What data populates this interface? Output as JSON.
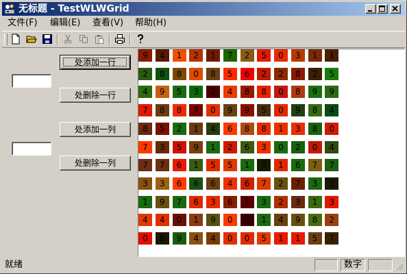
{
  "window": {
    "title": "无标题 - TestWLWGrid",
    "icon": "app-icon",
    "buttons": [
      "minimize-icon",
      "maximize-icon",
      "close-icon"
    ]
  },
  "menu": [
    "文件(F)",
    "编辑(E)",
    "查看(V)",
    "帮助(H)"
  ],
  "toolbar": {
    "tools": [
      "new-file-icon",
      "open-folder-icon",
      "save-icon",
      "cut-icon",
      "copy-icon",
      "paste-icon",
      "print-icon",
      "help-icon"
    ]
  },
  "panel": {
    "add_row": "处添加一行",
    "delete_row": "处删除一行",
    "add_col": "处添加一列",
    "delete_col": "处删除一列",
    "row_input_value": "",
    "col_input_value": ""
  },
  "grid": {
    "values": [
      [
        "9",
        "4",
        "1",
        "2",
        "1",
        "7",
        "2",
        "5",
        "0",
        "3",
        "1",
        "1"
      ],
      [
        "2",
        "8",
        "8",
        "0",
        "8",
        "5",
        "6",
        "2",
        "2",
        "8",
        "2",
        "5"
      ],
      [
        "4",
        "9",
        "5",
        "3",
        "2",
        "4",
        "8",
        "8",
        "0",
        "8",
        "9",
        "9"
      ],
      [
        "7",
        "8",
        "8",
        "7",
        "0",
        "9",
        "9",
        "5",
        "0",
        "9",
        "8",
        "4"
      ],
      [
        "8",
        "5",
        "2",
        "1",
        "4",
        "6",
        "8",
        "8",
        "1",
        "3",
        "8",
        "0"
      ],
      [
        "7",
        "3",
        "5",
        "9",
        "1",
        "2",
        "6",
        "3",
        "0",
        "2",
        "0",
        "4"
      ],
      [
        "7",
        "7",
        "6",
        "1",
        "5",
        "5",
        "1",
        "0",
        "1",
        "6",
        "7",
        "7"
      ],
      [
        "3",
        "3",
        "6",
        "6",
        "6",
        "4",
        "6",
        "7",
        "2",
        "7",
        "3",
        "2"
      ],
      [
        "1",
        "9",
        "7",
        "6",
        "3",
        "6",
        "7",
        "3",
        "2",
        "3",
        "1",
        "3"
      ],
      [
        "4",
        "4",
        "0",
        "1",
        "9",
        "0",
        "8",
        "1",
        "4",
        "9",
        "8",
        "2"
      ],
      [
        "0",
        "8",
        "9",
        "4",
        "4",
        "0",
        "0",
        "5",
        "1",
        "1",
        "5",
        "7"
      ]
    ],
    "colors": [
      [
        "#8b1a00",
        "#5a1a00",
        "#f05000",
        "#b83000",
        "#6e1a00",
        "#1e6400",
        "#8a5a14",
        "#e01a00",
        "#e82a00",
        "#b83a00",
        "#7a2a00",
        "#4a2000"
      ],
      [
        "#2a5a10",
        "#105010",
        "#7a4a00",
        "#e04a00",
        "#6a4010",
        "#ff2a00",
        "#f00000",
        "#c01a00",
        "#8a2a00",
        "#8a1a00",
        "#3a2000",
        "#1a7a10"
      ],
      [
        "#2a6a10",
        "#c86010",
        "#1a6a10",
        "#0a6a0a",
        "#4a0000",
        "#ee3a00",
        "#9a1a00",
        "#e82200",
        "#c01a10",
        "#b03a10",
        "#1a7010",
        "#2a6a10"
      ],
      [
        "#e01a00",
        "#6a3a10",
        "#f02a00",
        "#7a0000",
        "#e03000",
        "#6a4010",
        "#8a1000",
        "#4a2a10",
        "#e02800",
        "#204010",
        "#3a6a10",
        "#0a4a10"
      ],
      [
        "#6a2a10",
        "#7a1000",
        "#1a6a10",
        "#6a3a10",
        "#2a3a10",
        "#ff3a00",
        "#b04a10",
        "#e82a00",
        "#ee3000",
        "#e83000",
        "#1a6010",
        "#d01a00"
      ],
      [
        "#ff3a00",
        "#6a2a00",
        "#d01000",
        "#7a4010",
        "#1a6a10",
        "#d01a00",
        "#3a5a10",
        "#ee3000",
        "#1a6a10",
        "#1a6010",
        "#c01a00",
        "#304a10"
      ],
      [
        "#6a3010",
        "#6a3010",
        "#e81a00",
        "#3a5a10",
        "#e02a00",
        "#e03a00",
        "#1a6a10",
        "#1a1a00",
        "#e02800",
        "#1a6a10",
        "#7a6010",
        "#1a6010"
      ],
      [
        "#8a5010",
        "#a06010",
        "#ff3a00",
        "#1a5010",
        "#6a4010",
        "#f03000",
        "#cc2200",
        "#e03a00",
        "#6a5010",
        "#6a2000",
        "#1a6a10",
        "#1a1a00"
      ],
      [
        "#1a6a10",
        "#6a5010",
        "#1a6a10",
        "#e02a00",
        "#e82a00",
        "#8a2000",
        "#5a0000",
        "#1a6a10",
        "#b03000",
        "#6a2a10",
        "#3a6a10",
        "#e01a00"
      ],
      [
        "#e03a00",
        "#e03000",
        "#6a1000",
        "#8a3a10",
        "#5a5010",
        "#ff3a00",
        "#3a0000",
        "#1a6a10",
        "#6a4010",
        "#6a5010",
        "#4a6a10",
        "#9a4010"
      ],
      [
        "#e01000",
        "#1a1a00",
        "#1a5a10",
        "#8a5010",
        "#7a3a00",
        "#e03000",
        "#e02a00",
        "#e03a00",
        "#e81a00",
        "#e81a00",
        "#6a4010",
        "#3a2000"
      ]
    ]
  },
  "status": {
    "text": "就绪",
    "indicator": "数字"
  }
}
